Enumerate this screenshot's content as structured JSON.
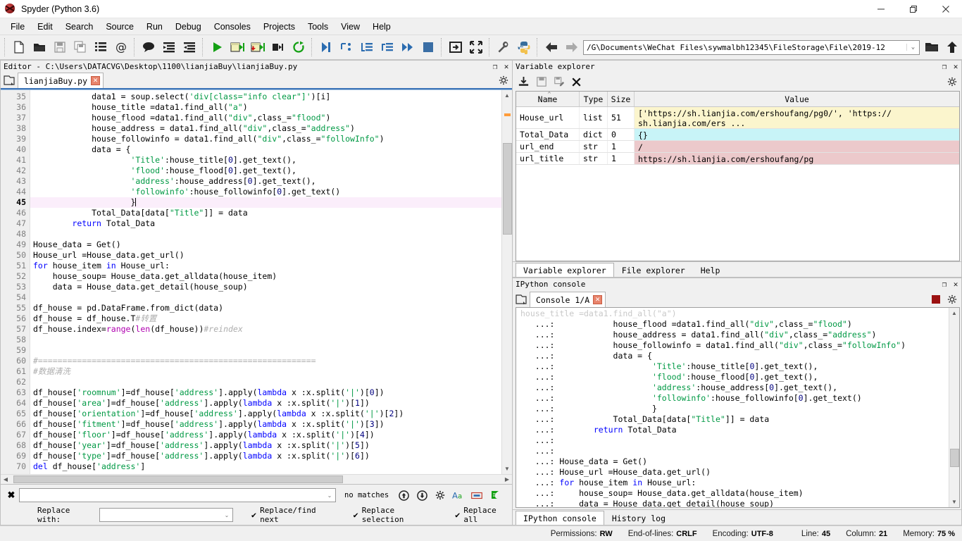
{
  "window": {
    "title": "Spyder (Python 3.6)",
    "app_icon": "spyder-logo-icon",
    "minimize": "−",
    "maximize": "❐",
    "close": "✕"
  },
  "menubar": {
    "items": [
      "File",
      "Edit",
      "Search",
      "Source",
      "Run",
      "Debug",
      "Consoles",
      "Projects",
      "Tools",
      "View",
      "Help"
    ]
  },
  "toolbar": {
    "buttons": [
      {
        "name": "new-file-icon",
        "tip": "New file"
      },
      {
        "name": "open-file-icon",
        "tip": "Open file"
      },
      {
        "name": "save-file-icon",
        "tip": "Save file"
      },
      {
        "name": "save-all-icon",
        "tip": "Save all"
      },
      {
        "name": "file-switcher-icon",
        "tip": "File switcher"
      },
      {
        "name": "find-symbol-icon",
        "tip": "Symbol finder"
      },
      {
        "name": "comment-icon",
        "tip": "Comment"
      },
      {
        "name": "unindent-icon",
        "tip": "Unindent"
      },
      {
        "name": "indent-icon",
        "tip": "Indent"
      },
      {
        "name": "run-file-icon",
        "tip": "Run file"
      },
      {
        "name": "run-cell-icon",
        "tip": "Run cell"
      },
      {
        "name": "run-cell-advance-icon",
        "tip": "Run cell and advance"
      },
      {
        "name": "run-selection-icon",
        "tip": "Run selection"
      },
      {
        "name": "rerun-icon",
        "tip": "Re-run last cell"
      },
      {
        "name": "debug-file-icon",
        "tip": "Debug file"
      },
      {
        "name": "step-over-icon",
        "tip": "Step over"
      },
      {
        "name": "step-into-icon",
        "tip": "Step into"
      },
      {
        "name": "step-return-icon",
        "tip": "Step return"
      },
      {
        "name": "continue-icon",
        "tip": "Continue"
      },
      {
        "name": "stop-debug-icon",
        "tip": "Stop debugging"
      },
      {
        "name": "maximize-pane-icon",
        "tip": "Maximize pane"
      },
      {
        "name": "fullscreen-icon",
        "tip": "Fullscreen"
      },
      {
        "name": "preferences-icon",
        "tip": "Preferences"
      },
      {
        "name": "pythonpath-icon",
        "tip": "PYTHONPATH manager"
      },
      {
        "name": "back-icon",
        "tip": "Back"
      },
      {
        "name": "forward-icon",
        "tip": "Forward"
      }
    ],
    "path_value": "/G\\Documents\\WeChat Files\\sywmalbh12345\\FileStorage\\File\\2019-12",
    "path_caret": "⌄",
    "browse_dir_icon": "open-folder-icon",
    "parent_dir_icon": "up-arrow-icon"
  },
  "editor_pane": {
    "title": "Editor - C:\\Users\\DATACVG\\Desktop\\1100\\lianjiaBuy\\lianjiaBuy.py",
    "undock": "❐",
    "close": "✕",
    "browse_tabs_icon": "browse-tabs-icon",
    "options_icon": "gear-icon",
    "tab": {
      "label": "lianjiaBuy.py",
      "close": "✕"
    },
    "first_line_number": 35,
    "current_line": 45,
    "lines": [
      {
        "n": 35,
        "html": "            data1 = soup.select(<s>'div[class=\"info clear\"]'</s>)[i]"
      },
      {
        "n": 36,
        "html": "            house_title =data1.find_all(<s>\"a\"</s>)"
      },
      {
        "n": 37,
        "html": "            house_flood =data1.find_all(<s>\"div\"</s>,class_=<s>\"flood\"</s>)"
      },
      {
        "n": 38,
        "html": "            house_address = data1.find_all(<s>\"div\"</s>,class_=<s>\"address\"</s>)"
      },
      {
        "n": 39,
        "html": "            house_followinfo = data1.find_all(<s>\"div\"</s>,class_=<s>\"followInfo\"</s>)"
      },
      {
        "n": 40,
        "html": "            data = {"
      },
      {
        "n": 41,
        "html": "                    <s>'Title'</s>:house_title[<z>0</z>].get_text(),"
      },
      {
        "n": 42,
        "html": "                    <s>'flood'</s>:house_flood[<z>0</z>].get_text(),"
      },
      {
        "n": 43,
        "html": "                    <s>'address'</s>:house_address[<z>0</z>].get_text(),"
      },
      {
        "n": 44,
        "html": "                    <s>'followinfo'</s>:house_followinfo[<z>0</z>].get_text()"
      },
      {
        "n": 45,
        "html": "                    }",
        "highlight": true,
        "cursor": true
      },
      {
        "n": 46,
        "html": "            Total_Data[data[<s>\"Title\"</s>]] = data"
      },
      {
        "n": 47,
        "html": "        <k>return</k> Total_Data"
      },
      {
        "n": 48,
        "html": ""
      },
      {
        "n": 49,
        "html": "House_data = Get()"
      },
      {
        "n": 50,
        "html": "House_url =House_data.get_url()"
      },
      {
        "n": 51,
        "html": "<k>for</k> house_item <k>in</k> House_url:"
      },
      {
        "n": 52,
        "html": "    house_soup= House_data.get_alldata(house_item)"
      },
      {
        "n": 53,
        "html": "    data = House_data.get_detail(house_soup)"
      },
      {
        "n": 54,
        "html": ""
      },
      {
        "n": 55,
        "html": "df_house = pd.DataFrame.from_dict(data)"
      },
      {
        "n": 56,
        "html": "df_house = df_house.T<c>#转置</c>"
      },
      {
        "n": 57,
        "html": "df_house.index=<b>range</b>(<b>len</b>(df_house))<c>#reindex</c>"
      },
      {
        "n": 58,
        "html": ""
      },
      {
        "n": 59,
        "html": ""
      },
      {
        "n": 60,
        "html": "<c>#=========================================================</c>"
      },
      {
        "n": 61,
        "html": "<c>#数据清洗</c>"
      },
      {
        "n": 62,
        "html": ""
      },
      {
        "n": 63,
        "html": "df_house[<s>'roomnum'</s>]=df_house[<s>'address'</s>].apply(<k>lambda</k> x :x.split(<s>'|'</s>)[<z>0</z>])"
      },
      {
        "n": 64,
        "html": "df_house[<s>'area'</s>]=df_house[<s>'address'</s>].apply(<k>lambda</k> x :x.split(<s>'|'</s>)[<z>1</z>])"
      },
      {
        "n": 65,
        "html": "df_house[<s>'orientation'</s>]=df_house[<s>'address'</s>].apply(<k>lambda</k> x :x.split(<s>'|'</s>)[<z>2</z>])"
      },
      {
        "n": 66,
        "html": "df_house[<s>'fitment'</s>]=df_house[<s>'address'</s>].apply(<k>lambda</k> x :x.split(<s>'|'</s>)[<z>3</z>])"
      },
      {
        "n": 67,
        "html": "df_house[<s>'floor'</s>]=df_house[<s>'address'</s>].apply(<k>lambda</k> x :x.split(<s>'|'</s>)[<z>4</z>])"
      },
      {
        "n": 68,
        "html": "df_house[<s>'year'</s>]=df_house[<s>'address'</s>].apply(<k>lambda</k> x :x.split(<s>'|'</s>)[<z>5</z>])"
      },
      {
        "n": 69,
        "html": "df_house[<s>'type'</s>]=df_house[<s>'address'</s>].apply(<k>lambda</k> x :x.split(<s>'|'</s>)[<z>6</z>])"
      },
      {
        "n": 70,
        "html": "<k>del</k> df_house[<s>'address'</s>]"
      }
    ]
  },
  "find_replace": {
    "close_icon": "close-icon",
    "search_value": "",
    "search_caret": "⌄",
    "status": "no matches",
    "find_previous_icon": "arrow-up-circle-icon",
    "find_next_icon": "arrow-down-circle-icon",
    "options_icon": "gear-icon",
    "case_sensitive_icon": "case-sensitive-icon",
    "whole_words_icon": "whole-words-icon",
    "regex_icon": "regex-icon",
    "replace_label": "Replace with:",
    "replace_value": "",
    "replace_caret": "⌄",
    "buttons": [
      {
        "label": "Replace/find next",
        "check": "✔"
      },
      {
        "label": "Replace selection",
        "check": "✔"
      },
      {
        "label": "Replace all",
        "check": "✔"
      }
    ]
  },
  "variable_explorer": {
    "title": "Variable explorer",
    "undock": "❐",
    "close": "✕",
    "toolbar": [
      {
        "name": "import-data-icon",
        "tip": "Import data"
      },
      {
        "name": "save-data-icon",
        "tip": "Save data"
      },
      {
        "name": "save-data-as-icon",
        "tip": "Save data as"
      },
      {
        "name": "remove-all-variables-icon",
        "tip": "Remove all variables"
      }
    ],
    "options_icon": "gear-icon",
    "columns": [
      "Name",
      "Type",
      "Size",
      "Value"
    ],
    "sort_indicator": "^",
    "rows": [
      {
        "name": "House_url",
        "type": "list",
        "size": "51",
        "value": "['https://sh.lianjia.com/ershoufang/pg0/', 'https://\nsh.lianjia.com/ers ...",
        "color": "#fbf5cd"
      },
      {
        "name": "Total_Data",
        "type": "dict",
        "size": "0",
        "value": "{}",
        "color": "#c8f4f7"
      },
      {
        "name": "url_end",
        "type": "str",
        "size": "1",
        "value": "/",
        "color": "#ecc9cb"
      },
      {
        "name": "url_title",
        "type": "str",
        "size": "1",
        "value": "https://sh.lianjia.com/ershoufang/pg",
        "color": "#ecc9cb"
      }
    ],
    "bottom_tabs": [
      {
        "label": "Variable explorer",
        "active": true
      },
      {
        "label": "File explorer",
        "active": false
      },
      {
        "label": "Help",
        "active": false
      }
    ]
  },
  "console": {
    "title": "IPython console",
    "undock": "❐",
    "close": "✕",
    "browse_tabs_icon": "browse-tabs-icon",
    "tab": {
      "label": "Console 1/A",
      "close": "✕"
    },
    "stop_icon": "stop-icon",
    "options_icon": "gear-icon",
    "lines": [
      {
        "prompt": "",
        "html": "<clip>house_title =data1.find_all(\"a\")</clip>",
        "clipped": true
      },
      {
        "prompt": "   ...:",
        "html": "            house_flood =data1.find_all(<s>\"div\"</s>,class_=<s>\"flood\"</s>)"
      },
      {
        "prompt": "   ...:",
        "html": "            house_address = data1.find_all(<s>\"div\"</s>,class_=<s>\"address\"</s>)"
      },
      {
        "prompt": "   ...:",
        "html": "            house_followinfo = data1.find_all(<s>\"div\"</s>,class_=<s>\"followInfo\"</s>)"
      },
      {
        "prompt": "   ...:",
        "html": "            data = {"
      },
      {
        "prompt": "   ...:",
        "html": "                    <s>'Title'</s>:house_title[<z>0</z>].get_text(),"
      },
      {
        "prompt": "   ...:",
        "html": "                    <s>'flood'</s>:house_flood[<z>0</z>].get_text(),"
      },
      {
        "prompt": "   ...:",
        "html": "                    <s>'address'</s>:house_address[<z>0</z>].get_text(),"
      },
      {
        "prompt": "   ...:",
        "html": "                    <s>'followinfo'</s>:house_followinfo[<z>0</z>].get_text()"
      },
      {
        "prompt": "   ...:",
        "html": "                    }"
      },
      {
        "prompt": "   ...:",
        "html": "            Total_Data[data[<s>\"Title\"</s>]] = data"
      },
      {
        "prompt": "   ...:",
        "html": "        <k>return</k> Total_Data"
      },
      {
        "prompt": "   ...:",
        "html": ""
      },
      {
        "prompt": "   ...:",
        "html": ""
      },
      {
        "prompt": "   ...:",
        "html": " House_data = Get()"
      },
      {
        "prompt": "   ...:",
        "html": " House_url =House_data.get_url()"
      },
      {
        "prompt": "   ...:",
        "html": " <k>for</k> house_item <k>in</k> House_url:"
      },
      {
        "prompt": "   ...:",
        "html": "     house_soup= House_data.get_alldata(house_item)"
      },
      {
        "prompt": "   ...:",
        "html": "     data = House_data.get_detail(house_soup)"
      }
    ],
    "bottom_tabs": [
      {
        "label": "IPython console",
        "active": true
      },
      {
        "label": "History log",
        "active": false
      }
    ]
  },
  "statusbar": {
    "items": [
      {
        "label": "Permissions:",
        "value": "RW"
      },
      {
        "label": "End-of-lines:",
        "value": "CRLF"
      },
      {
        "label": "Encoding:",
        "value": "UTF-8"
      },
      {
        "label": "Line:",
        "value": "45"
      },
      {
        "label": "Column:",
        "value": "21"
      },
      {
        "label": "Memory:",
        "value": "75 %"
      }
    ]
  },
  "colors": {
    "accent_blue": "#3c74b8",
    "string_green": "#009944",
    "keyword_blue": "#0000ff",
    "comment_gray": "#adadad",
    "run_green": "#14a014",
    "debug_blue": "#2b6cb0",
    "highlight_line": "#fbeefb"
  }
}
